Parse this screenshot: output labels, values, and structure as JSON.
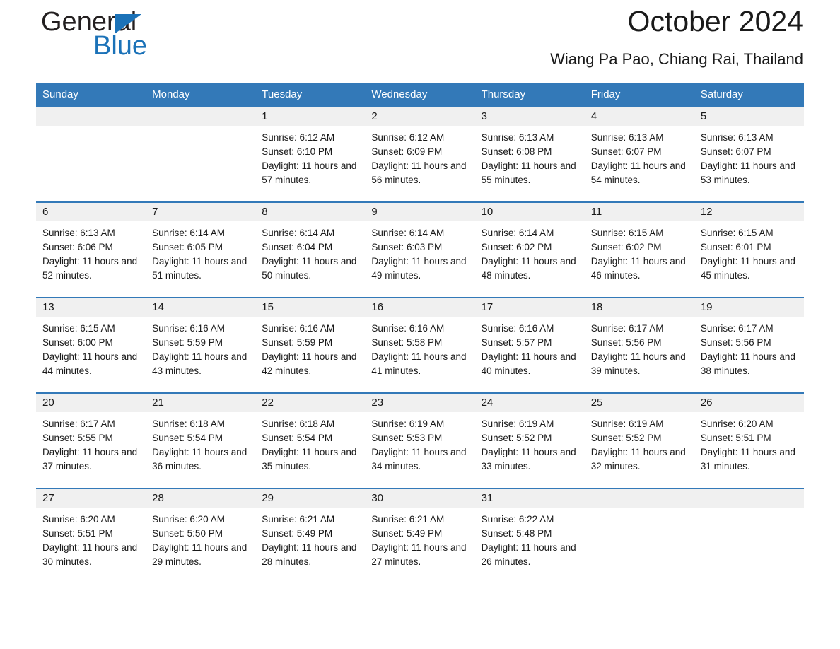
{
  "brand": {
    "name_part1": "General",
    "name_part2": "Blue",
    "accent_color": "#1b72b8"
  },
  "header": {
    "title": "October 2024",
    "subtitle": "Wiang Pa Pao, Chiang Rai, Thailand",
    "header_bg_color": "#3379b8",
    "daynum_band_color": "#f0f0f0"
  },
  "weekday_headers": [
    "Sunday",
    "Monday",
    "Tuesday",
    "Wednesday",
    "Thursday",
    "Friday",
    "Saturday"
  ],
  "weeks": [
    [
      {
        "empty": true
      },
      {
        "empty": true
      },
      {
        "day": "1",
        "sunrise": "Sunrise: 6:12 AM",
        "sunset": "Sunset: 6:10 PM",
        "daylight": "Daylight: 11 hours and 57 minutes."
      },
      {
        "day": "2",
        "sunrise": "Sunrise: 6:12 AM",
        "sunset": "Sunset: 6:09 PM",
        "daylight": "Daylight: 11 hours and 56 minutes."
      },
      {
        "day": "3",
        "sunrise": "Sunrise: 6:13 AM",
        "sunset": "Sunset: 6:08 PM",
        "daylight": "Daylight: 11 hours and 55 minutes."
      },
      {
        "day": "4",
        "sunrise": "Sunrise: 6:13 AM",
        "sunset": "Sunset: 6:07 PM",
        "daylight": "Daylight: 11 hours and 54 minutes."
      },
      {
        "day": "5",
        "sunrise": "Sunrise: 6:13 AM",
        "sunset": "Sunset: 6:07 PM",
        "daylight": "Daylight: 11 hours and 53 minutes."
      }
    ],
    [
      {
        "day": "6",
        "sunrise": "Sunrise: 6:13 AM",
        "sunset": "Sunset: 6:06 PM",
        "daylight": "Daylight: 11 hours and 52 minutes."
      },
      {
        "day": "7",
        "sunrise": "Sunrise: 6:14 AM",
        "sunset": "Sunset: 6:05 PM",
        "daylight": "Daylight: 11 hours and 51 minutes."
      },
      {
        "day": "8",
        "sunrise": "Sunrise: 6:14 AM",
        "sunset": "Sunset: 6:04 PM",
        "daylight": "Daylight: 11 hours and 50 minutes."
      },
      {
        "day": "9",
        "sunrise": "Sunrise: 6:14 AM",
        "sunset": "Sunset: 6:03 PM",
        "daylight": "Daylight: 11 hours and 49 minutes."
      },
      {
        "day": "10",
        "sunrise": "Sunrise: 6:14 AM",
        "sunset": "Sunset: 6:02 PM",
        "daylight": "Daylight: 11 hours and 48 minutes."
      },
      {
        "day": "11",
        "sunrise": "Sunrise: 6:15 AM",
        "sunset": "Sunset: 6:02 PM",
        "daylight": "Daylight: 11 hours and 46 minutes."
      },
      {
        "day": "12",
        "sunrise": "Sunrise: 6:15 AM",
        "sunset": "Sunset: 6:01 PM",
        "daylight": "Daylight: 11 hours and 45 minutes."
      }
    ],
    [
      {
        "day": "13",
        "sunrise": "Sunrise: 6:15 AM",
        "sunset": "Sunset: 6:00 PM",
        "daylight": "Daylight: 11 hours and 44 minutes."
      },
      {
        "day": "14",
        "sunrise": "Sunrise: 6:16 AM",
        "sunset": "Sunset: 5:59 PM",
        "daylight": "Daylight: 11 hours and 43 minutes."
      },
      {
        "day": "15",
        "sunrise": "Sunrise: 6:16 AM",
        "sunset": "Sunset: 5:59 PM",
        "daylight": "Daylight: 11 hours and 42 minutes."
      },
      {
        "day": "16",
        "sunrise": "Sunrise: 6:16 AM",
        "sunset": "Sunset: 5:58 PM",
        "daylight": "Daylight: 11 hours and 41 minutes."
      },
      {
        "day": "17",
        "sunrise": "Sunrise: 6:16 AM",
        "sunset": "Sunset: 5:57 PM",
        "daylight": "Daylight: 11 hours and 40 minutes."
      },
      {
        "day": "18",
        "sunrise": "Sunrise: 6:17 AM",
        "sunset": "Sunset: 5:56 PM",
        "daylight": "Daylight: 11 hours and 39 minutes."
      },
      {
        "day": "19",
        "sunrise": "Sunrise: 6:17 AM",
        "sunset": "Sunset: 5:56 PM",
        "daylight": "Daylight: 11 hours and 38 minutes."
      }
    ],
    [
      {
        "day": "20",
        "sunrise": "Sunrise: 6:17 AM",
        "sunset": "Sunset: 5:55 PM",
        "daylight": "Daylight: 11 hours and 37 minutes."
      },
      {
        "day": "21",
        "sunrise": "Sunrise: 6:18 AM",
        "sunset": "Sunset: 5:54 PM",
        "daylight": "Daylight: 11 hours and 36 minutes."
      },
      {
        "day": "22",
        "sunrise": "Sunrise: 6:18 AM",
        "sunset": "Sunset: 5:54 PM",
        "daylight": "Daylight: 11 hours and 35 minutes."
      },
      {
        "day": "23",
        "sunrise": "Sunrise: 6:19 AM",
        "sunset": "Sunset: 5:53 PM",
        "daylight": "Daylight: 11 hours and 34 minutes."
      },
      {
        "day": "24",
        "sunrise": "Sunrise: 6:19 AM",
        "sunset": "Sunset: 5:52 PM",
        "daylight": "Daylight: 11 hours and 33 minutes."
      },
      {
        "day": "25",
        "sunrise": "Sunrise: 6:19 AM",
        "sunset": "Sunset: 5:52 PM",
        "daylight": "Daylight: 11 hours and 32 minutes."
      },
      {
        "day": "26",
        "sunrise": "Sunrise: 6:20 AM",
        "sunset": "Sunset: 5:51 PM",
        "daylight": "Daylight: 11 hours and 31 minutes."
      }
    ],
    [
      {
        "day": "27",
        "sunrise": "Sunrise: 6:20 AM",
        "sunset": "Sunset: 5:51 PM",
        "daylight": "Daylight: 11 hours and 30 minutes."
      },
      {
        "day": "28",
        "sunrise": "Sunrise: 6:20 AM",
        "sunset": "Sunset: 5:50 PM",
        "daylight": "Daylight: 11 hours and 29 minutes."
      },
      {
        "day": "29",
        "sunrise": "Sunrise: 6:21 AM",
        "sunset": "Sunset: 5:49 PM",
        "daylight": "Daylight: 11 hours and 28 minutes."
      },
      {
        "day": "30",
        "sunrise": "Sunrise: 6:21 AM",
        "sunset": "Sunset: 5:49 PM",
        "daylight": "Daylight: 11 hours and 27 minutes."
      },
      {
        "day": "31",
        "sunrise": "Sunrise: 6:22 AM",
        "sunset": "Sunset: 5:48 PM",
        "daylight": "Daylight: 11 hours and 26 minutes."
      },
      {
        "empty": true
      },
      {
        "empty": true
      }
    ]
  ]
}
